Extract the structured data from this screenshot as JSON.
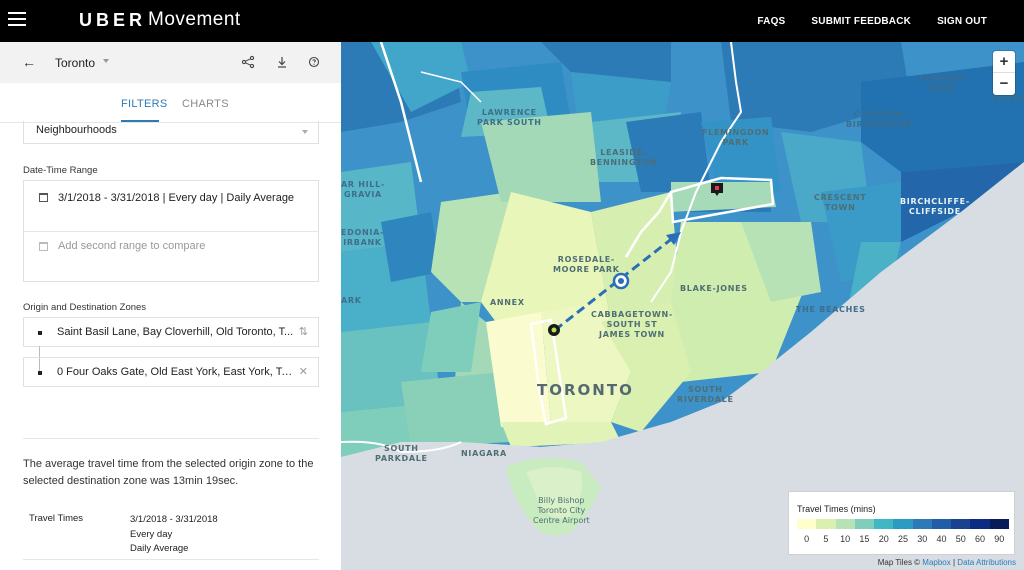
{
  "topbar": {
    "brand": "UBER",
    "product": "Movement",
    "links": [
      "FAQS",
      "SUBMIT FEEDBACK",
      "SIGN OUT"
    ]
  },
  "panel": {
    "city": "Toronto",
    "tabs": [
      {
        "label": "FILTERS",
        "active": true
      },
      {
        "label": "CHARTS",
        "active": false
      }
    ],
    "zone_type": "Neighbourhoods",
    "date_time_label": "Date-Time Range",
    "range1": "3/1/2018 - 3/31/2018 | Every day | Daily Average",
    "range2_placeholder": "Add second range to compare",
    "od_label": "Origin and Destination Zones",
    "origin": "Saint Basil Lane, Bay Cloverhill, Old Toronto, T...",
    "destination": "0 Four Oaks Gate, Old East York, East York, Tor...",
    "summary": "The average travel time from the selected origin zone to the selected destination zone was 13min 19sec.",
    "travel_times_label": "Travel Times",
    "travel_times": [
      "3/1/2018 - 3/31/2018",
      "Every day",
      "Daily Average"
    ]
  },
  "map": {
    "city_label": "TORONTO",
    "labels": {
      "lawrence": "LAWRENCE\nPARK SOUTH",
      "leaside": "LEASIDE-\nBENNINGTON",
      "flemingdon": "FLEMINGDON\nPARK",
      "kennedy": "KENNEDY\nPARK",
      "clairlea": "CLAIRLEA-\nBIRCHMOUNT",
      "cliffside": "CLIFFC",
      "crescent": "CRESCENT\nTOWN",
      "birchcliffe": "BIRCHCLIFFE-\nCLIFFSIDE",
      "rosedale": "ROSEDALE-\nMOORE PARK",
      "blake": "BLAKE-JONES",
      "beaches": "THE BEACHES",
      "annex": "ANNEX",
      "cabbagetown": "CABBAGETOWN-\nSOUTH ST\nJAMES TOWN",
      "southriverdale": "SOUTH\nRIVERDALE",
      "southparkdale": "SOUTH\nPARKDALE",
      "niagara": "NIAGARA",
      "airport": "Billy Bishop\nToronto City\nCentre Airport",
      "cedarhill": "AR HILL-\nGRAVIA",
      "caledonia": "EDONIA-\nIRBANK",
      "park": "ARK"
    },
    "legend_title": "Travel Times (mins)",
    "legend_ticks": [
      "0",
      "5",
      "10",
      "15",
      "20",
      "25",
      "30",
      "40",
      "50",
      "60",
      "90"
    ],
    "legend_colors": [
      "#ffffcc",
      "#d9f0b0",
      "#b7e2b6",
      "#7fcdbb",
      "#41b6c4",
      "#2c9bc4",
      "#2c7bb6",
      "#225ea8",
      "#1a428f",
      "#0c2c84",
      "#081d58"
    ],
    "attribution_prefix": "Map Tiles ©",
    "attribution_link1": "Mapbox",
    "attribution_link2": "Data Attributions"
  }
}
